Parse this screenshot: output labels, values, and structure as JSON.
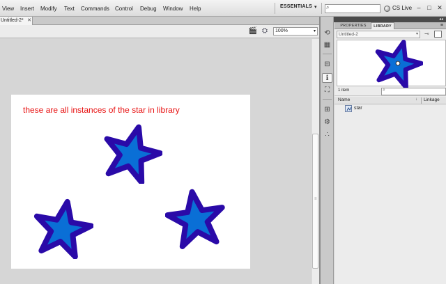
{
  "menu": [
    "View",
    "Insert",
    "Modify",
    "Text",
    "Commands",
    "Control",
    "Debug",
    "Window",
    "Help"
  ],
  "workspace": {
    "label": "ESSENTIALS",
    "arrow": "▾"
  },
  "search": {
    "placeholder": "",
    "icon": "search-icon"
  },
  "cslive": {
    "label": "CS Live",
    "icon": "cslive-icon"
  },
  "window_controls": {
    "minimize": "–",
    "restore": "□",
    "close": "✕"
  },
  "document_tab": {
    "title": "Untitled-2*",
    "close": "✕"
  },
  "editbar": {
    "zoom": "100%",
    "zoom_arrow": "▾"
  },
  "stage": {
    "caption": "these are all instances of the star in library",
    "background": "#ffffff",
    "caption_color": "#e81010"
  },
  "star_colors": {
    "fill": "#0a6fd6",
    "stroke": "#2a0aa8"
  },
  "panel": {
    "collapse_label": "◂◂",
    "tabs": [
      "PROPERTIES",
      "LIBRARY"
    ],
    "active_tab": "LIBRARY",
    "menu_icon": "≡",
    "document_select": "Untitled-2",
    "select_arrow": "▾",
    "item_count": "1 item",
    "search_icon": "⌕",
    "columns": {
      "name": "Name",
      "sort": "↓",
      "linkage": "Linkage"
    },
    "items": [
      {
        "name": "star",
        "icon": "movieclip-symbol-icon"
      }
    ]
  }
}
